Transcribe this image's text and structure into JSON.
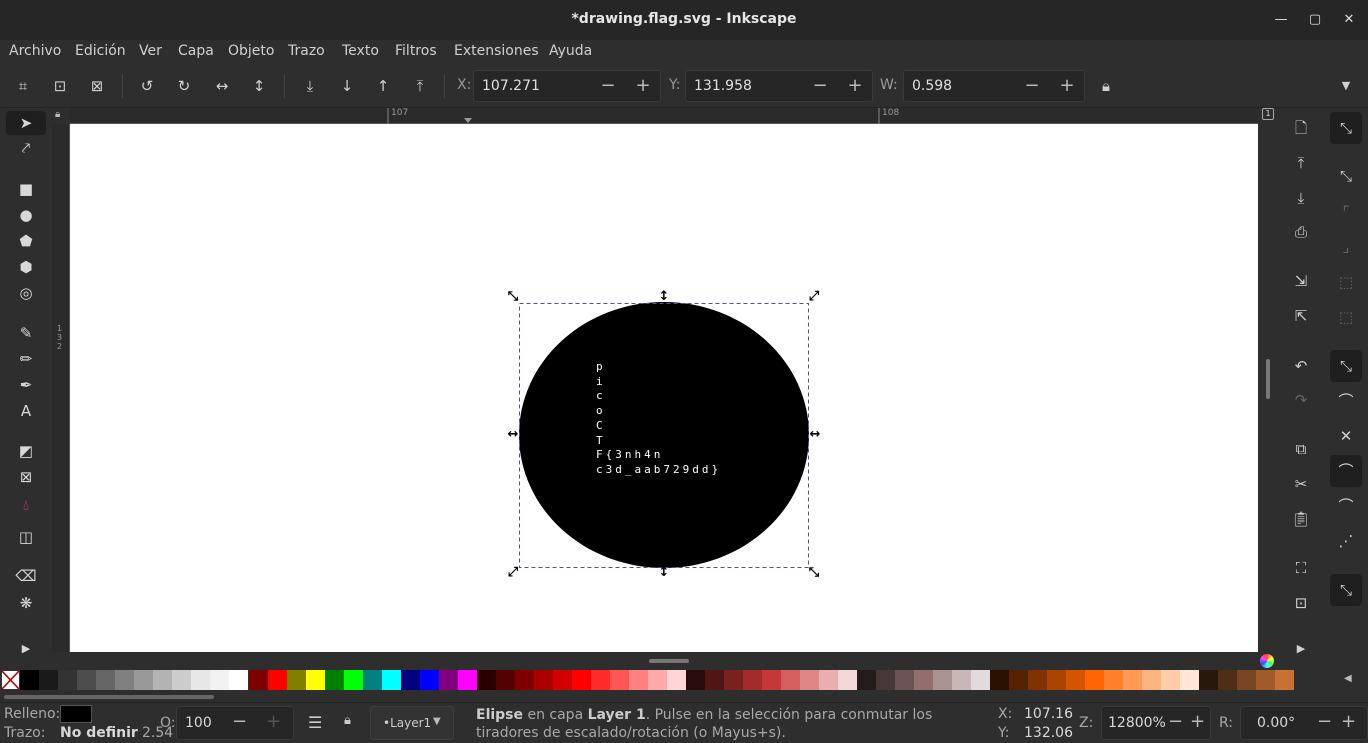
{
  "window": {
    "title": "*drawing.flag.svg - Inkscape"
  },
  "menu": [
    "Archivo",
    "Edición",
    "Ver",
    "Capa",
    "Objeto",
    "Trazo",
    "Texto",
    "Filtros",
    "Extensiones",
    "Ayuda"
  ],
  "toolctrl": {
    "x_label": "X:",
    "x_value": "107.271",
    "y_label": "Y:",
    "y_value": "131.958",
    "w_label": "W:",
    "w_value": "0.598"
  },
  "ruler": {
    "tick1": "107",
    "tick2": "108",
    "left_ticks": "1\n3\n2"
  },
  "canvas": {
    "flag_lines": [
      "p",
      "i",
      "c",
      "o",
      "C",
      "T",
      "F{3nh4n",
      "c3d_aab729dd}"
    ]
  },
  "status": {
    "fill_label": "Relleno:",
    "stroke_label": "Trazo:",
    "stroke_value": "No definir",
    "stroke_width": "2.54",
    "opacity_label": "O:",
    "opacity_value": "100",
    "layer": "•Layer1",
    "message_bold": "Elipse",
    "message_mid": " en capa ",
    "message_layer": "Layer 1",
    "message_rest": ". Pulse en la selección para conmutar los tiradores de escalado/rotación (o Mayus+s).",
    "cursor_x_label": "X:",
    "cursor_x": "107.16",
    "cursor_y_label": "Y:",
    "cursor_y": "132.06",
    "zoom_label": "Z:",
    "zoom_value": "12800%",
    "rotate_label": "R:",
    "rotate_value": "0.00°"
  },
  "colors": {
    "palette_grays": [
      "#000000",
      "#1a1a1a",
      "#333333",
      "#4d4d4d",
      "#666666",
      "#808080",
      "#999999",
      "#b3b3b3",
      "#cccccc",
      "#e6e6e6",
      "#f2f2f2",
      "#ffffff"
    ],
    "palette_colors": [
      "#800000",
      "#ff0000",
      "#808000",
      "#ffff00",
      "#008000",
      "#00ff00",
      "#008080",
      "#00ffff",
      "#000080",
      "#0000ff",
      "#800080",
      "#ff00ff",
      "#2b0000",
      "#550000",
      "#800000",
      "#aa0000",
      "#d40000",
      "#ff0000",
      "#ff2a2a",
      "#ff5555",
      "#ff8080",
      "#ffaaaa",
      "#ffd5d5",
      "#280b0b",
      "#501616",
      "#782121",
      "#a02c2c",
      "#c83737",
      "#d35f5f",
      "#de8787",
      "#e9afaf",
      "#f4d7d7",
      "#241c1c",
      "#483737",
      "#6c5353",
      "#916f6f",
      "#ac9393",
      "#c8b7b7",
      "#e3dbdb",
      "#2b1100",
      "#552200",
      "#803300",
      "#aa4400",
      "#d45500",
      "#ff6600",
      "#ff7f2a",
      "#ff9955",
      "#ffb380",
      "#ffccaa",
      "#ffe6d5",
      "#28170b",
      "#502d16",
      "#784421",
      "#a05a2c",
      "#c87137"
    ]
  }
}
